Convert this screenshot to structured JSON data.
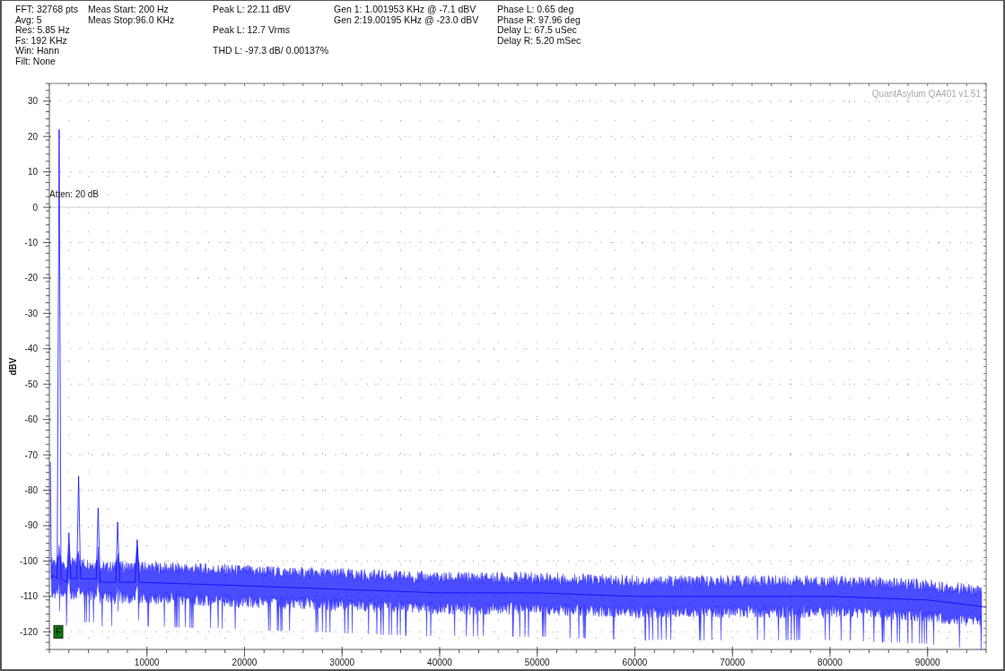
{
  "readouts": {
    "col_1": [
      {
        "text": "FFT: 32768 pts"
      },
      {
        "text": "Avg: 5"
      },
      {
        "text": "Res: 5.85 Hz"
      },
      {
        "text": "Fs: 192 KHz"
      },
      {
        "text": "Win: Hann"
      },
      {
        "text": "Filt: None"
      }
    ],
    "col_2": [
      {
        "text": "Meas Start: 200 Hz"
      },
      {
        "text": "Meas Stop:96.0 KHz"
      }
    ],
    "col_3": [
      {
        "text": "Peak L: 22.11 dBV"
      },
      {
        "text": "Peak L: 12.7 Vrms"
      },
      {
        "text": "THD L: -97.3 dB/ 0.00137%"
      }
    ],
    "col_4": [
      {
        "text": "Gen 1: 1.001953 KHz @ -7.1  dBV"
      },
      {
        "text": "Gen 2:19.00195 KHz @ -23.0  dBV"
      }
    ],
    "col_5": [
      {
        "text": "Phase L: 0.65 deg"
      },
      {
        "text": "Phase R: 97.96 deg"
      },
      {
        "text": "Delay L: 67.5 uSec"
      },
      {
        "text": "Delay R: 5.20 mSec"
      }
    ]
  },
  "plot": {
    "version_label": "QuantAsylum QA401 v1.51",
    "atten_label": "Atten: 20 dB",
    "marker_button": "F",
    "chart_data": {
      "type": "line",
      "ylabel": "dBV",
      "xlim": [
        0,
        96000
      ],
      "ylim": [
        -125,
        35
      ],
      "grid": true,
      "xticks": [
        {
          "value": 10000,
          "label": "10000"
        },
        {
          "value": 20000,
          "label": "20000"
        },
        {
          "value": 30000,
          "label": "30000"
        },
        {
          "value": 40000,
          "label": "40000"
        },
        {
          "value": 50000,
          "label": "50000"
        },
        {
          "value": 60000,
          "label": "60000"
        },
        {
          "value": 70000,
          "label": "70000"
        },
        {
          "value": 80000,
          "label": "80000"
        },
        {
          "value": 90000,
          "label": "90000"
        }
      ],
      "yticks": [
        {
          "value": 30,
          "label": "30"
        },
        {
          "value": 20,
          "label": "20"
        },
        {
          "value": 10,
          "label": "10"
        },
        {
          "value": 0,
          "label": "0"
        },
        {
          "value": -10,
          "label": "-10"
        },
        {
          "value": -20,
          "label": "-20"
        },
        {
          "value": -30,
          "label": "-30"
        },
        {
          "value": -40,
          "label": "-40"
        },
        {
          "value": -50,
          "label": "-50"
        },
        {
          "value": -60,
          "label": "-60"
        },
        {
          "value": -70,
          "label": "-70"
        },
        {
          "value": -80,
          "label": "-80"
        },
        {
          "value": -90,
          "label": "-90"
        },
        {
          "value": -100,
          "label": "-100"
        },
        {
          "value": -110,
          "label": "-110"
        },
        {
          "value": -120,
          "label": "-120"
        }
      ],
      "x": [
        100,
        200,
        400,
        800,
        1000,
        1200,
        1800,
        2000,
        2200,
        2800,
        3000,
        3200,
        4800,
        5000,
        5200,
        6800,
        7000,
        7200,
        8800,
        9000,
        9200,
        20000,
        30000,
        40000,
        50000,
        60000,
        70000,
        80000,
        90000,
        96000
      ],
      "series": [
        {
          "color": "#0000ff",
          "values": [
            -72,
            -105,
            -104,
            -105,
            22,
            -105,
            -106,
            -92,
            -105,
            -105,
            -76,
            -105,
            -105,
            -85,
            -106,
            -106,
            -89,
            -106,
            -106,
            -94,
            -106,
            -107,
            -108,
            -109,
            -109,
            -110,
            -110,
            -110,
            -111,
            -113
          ]
        }
      ]
    }
  }
}
